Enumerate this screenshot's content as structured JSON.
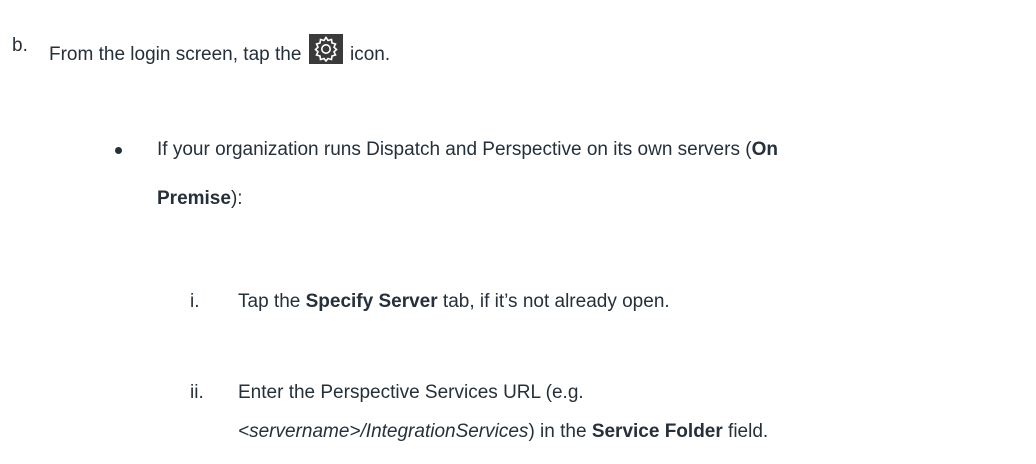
{
  "step_b": {
    "marker": "b.",
    "text_before": "From the login screen, tap the",
    "icon": "gear-icon",
    "text_after": "icon."
  },
  "bullet": {
    "text_1": "If your organization runs Dispatch and Perspective on its own servers (",
    "bold_1": "On",
    "bold_2": "Premise",
    "text_2": "):"
  },
  "sub_i": {
    "marker": "i.",
    "text_1": "Tap the",
    "bold": "Specify Server",
    "text_2": "tab, if it’s not already open."
  },
  "sub_ii": {
    "marker": "ii.",
    "line_1": "Enter the Perspective Services URL (e.g.",
    "italic": "<servername>/IntegrationServices",
    "text_2": ") in the",
    "bold": "Service Folder",
    "text_3": "field."
  }
}
